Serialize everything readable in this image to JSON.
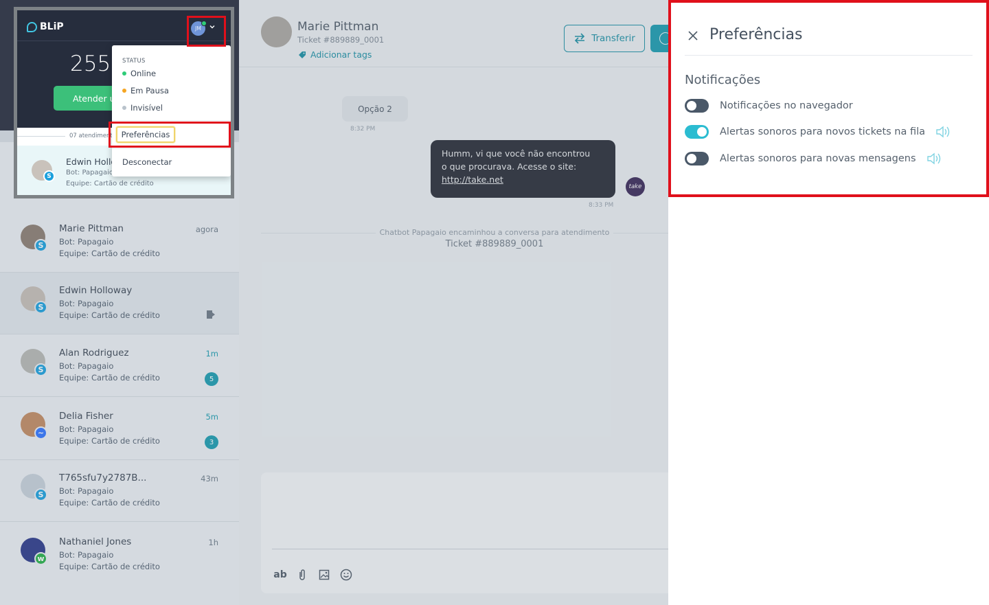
{
  "brand": {
    "name": "BLiP"
  },
  "popup": {
    "avatar_initials": "JM",
    "queue_count": "255",
    "attend_button": "Atender u",
    "queue_label": "07 atendiment",
    "status_heading": "STATUS",
    "status_options": [
      {
        "label": "Online",
        "color": "#2fcc78"
      },
      {
        "label": "Em Pausa",
        "color": "#f5a623"
      },
      {
        "label": "Invisível",
        "color": "#b9c2cb"
      }
    ],
    "preferences_label": "Preferências",
    "disconnect_label": "Desconectar",
    "item": {
      "name": "Edwin Hollo",
      "bot": "Bot: Papagaio",
      "team": "Equipe: Cartão de crédito"
    }
  },
  "conversations": [
    {
      "name": "Marie Pittman",
      "bot": "Bot: Papagaio",
      "team": "Equipe: Cartão de crédito",
      "time": "agora",
      "channel": "skype",
      "count": "",
      "selected": false
    },
    {
      "name": "Edwin Holloway",
      "bot": "Bot: Papagaio",
      "team": "Equipe: Cartão de crédito",
      "time": "",
      "channel": "skype",
      "count": "",
      "selected": true
    },
    {
      "name": "Alan Rodriguez",
      "bot": "Bot: Papagaio",
      "team": "Equipe: Cartão de crédito",
      "time": "1m",
      "channel": "skype",
      "count": "5",
      "selected": false
    },
    {
      "name": "Delia Fisher",
      "bot": "Bot: Papagaio",
      "team": "Equipe: Cartão de crédito",
      "time": "5m",
      "channel": "messenger",
      "count": "3",
      "selected": false
    },
    {
      "name": "T765sfu7y2787B...",
      "bot": "Bot: Papagaio",
      "team": "Equipe: Cartão de crédito",
      "time": "43m",
      "channel": "skype",
      "count": "",
      "selected": false
    },
    {
      "name": "Nathaniel Jones",
      "bot": "Bot: Papagaio",
      "team": "Equipe: Cartão de crédito",
      "time": "1h",
      "channel": "whatsapp",
      "count": "",
      "selected": false
    }
  ],
  "chat": {
    "contact_name": "Marie Pittman",
    "ticket": "Ticket #889889_0001",
    "add_tags": "Adicionar tags",
    "transfer_button": "Transferir",
    "messages": {
      "incoming": {
        "text": "Opção 2",
        "time": "8:32 PM"
      },
      "outgoing": {
        "line1": "Humm, vi que você não encontrou",
        "line2": "o que procurava. Acesse o site:",
        "link": "http://take.net ",
        "time": "8:33 PM",
        "avatar_text": "take"
      }
    },
    "system_message": "Chatbot Papagaio encaminhou a conversa para atendimento",
    "system_ticket": "Ticket #889889_0001",
    "composer": {
      "format_label": "ab"
    }
  },
  "preferences": {
    "title": "Preferências",
    "section": "Notificações",
    "toggles": [
      {
        "label": "Notificações no navegador",
        "on": false,
        "sound": false
      },
      {
        "label": "Alertas sonoros para novos tickets na fila",
        "on": true,
        "sound": true
      },
      {
        "label": "Alertas sonoros para novas mensagens",
        "on": false,
        "sound": true
      }
    ]
  },
  "colors": {
    "accent": "#1a9cb0",
    "toggle_on": "#2bbcd1",
    "highlight_red": "#e0101b",
    "dark_nav": "#262d3d"
  }
}
